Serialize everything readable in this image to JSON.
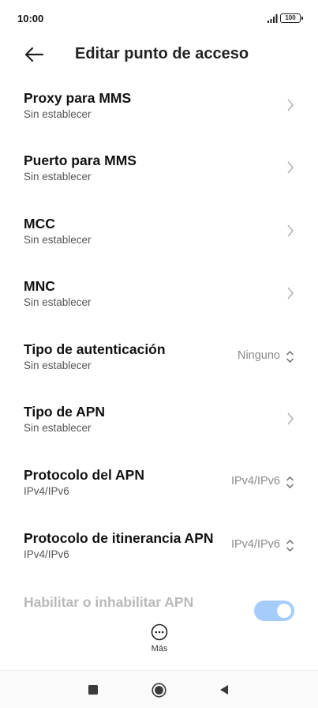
{
  "status_bar": {
    "time": "10:00",
    "battery": "100"
  },
  "header": {
    "title": "Editar punto de acceso"
  },
  "rows": [
    {
      "title": "Proxy para MMS",
      "subtitle": "Sin establecer"
    },
    {
      "title": "Puerto para MMS",
      "subtitle": "Sin establecer"
    },
    {
      "title": "MCC",
      "subtitle": "Sin establecer"
    },
    {
      "title": "MNC",
      "subtitle": "Sin establecer"
    },
    {
      "title": "Tipo de autenticación",
      "subtitle": "Sin establecer",
      "value": "Ninguno"
    },
    {
      "title": "Tipo de APN",
      "subtitle": "Sin establecer"
    },
    {
      "title": "Protocolo del APN",
      "subtitle": "IPv4/IPv6",
      "value": "IPv4/IPv6"
    },
    {
      "title": "Protocolo de itinerancia APN",
      "subtitle": "IPv4/IPv6",
      "value": "IPv4/IPv6"
    },
    {
      "title": "Habilitar o inhabilitar APN",
      "toggle_on": true
    }
  ],
  "more": {
    "label": "Más"
  },
  "colors": {
    "toggle_track": "#a5cdfb",
    "accent": "#3d8ef6"
  }
}
